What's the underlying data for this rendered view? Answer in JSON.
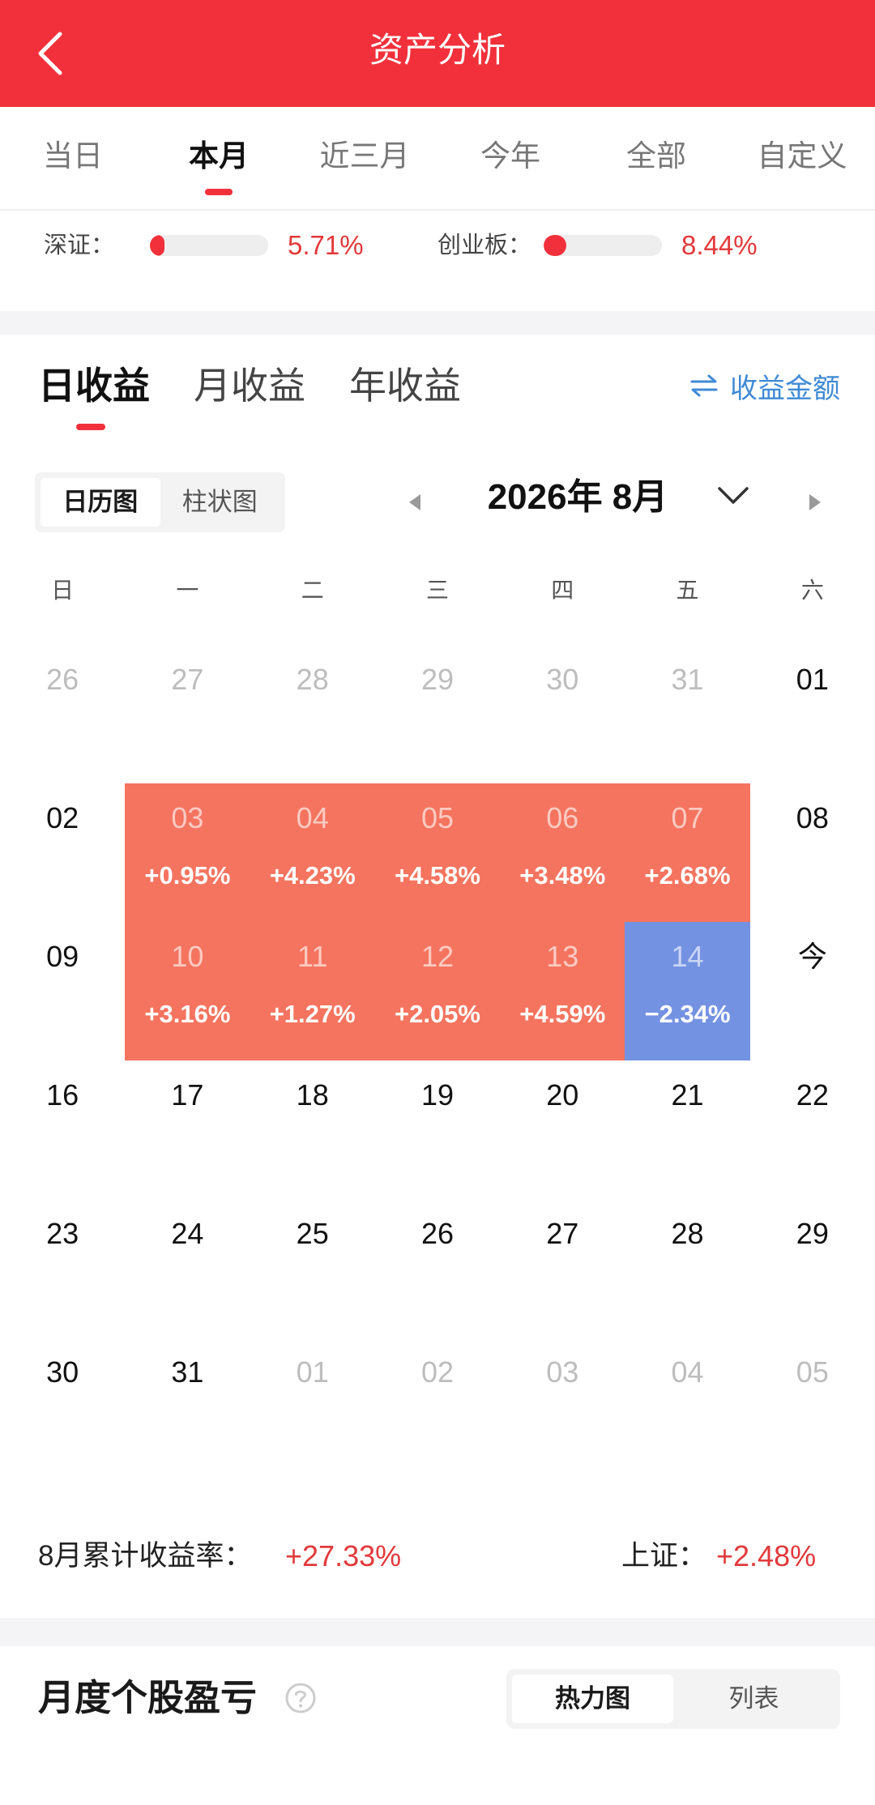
{
  "colors": {
    "brand_red": "#F2303B",
    "gain_text": "#E2393B",
    "gain_cell": "#F5745F",
    "loss_cell": "#7492E2",
    "link_blue": "#3F8AD5"
  },
  "header": {
    "title": "资产分析",
    "back_icon": "chevron-left-icon"
  },
  "period_tabs": {
    "items": [
      {
        "label": "当日",
        "active": false
      },
      {
        "label": "本月",
        "active": true
      },
      {
        "label": "近三月",
        "active": false
      },
      {
        "label": "今年",
        "active": false
      },
      {
        "label": "全部",
        "active": false
      },
      {
        "label": "自定义",
        "active": false
      }
    ]
  },
  "indices": [
    {
      "name": "深证：",
      "value": "5.71%",
      "bar_fill": 0.12
    },
    {
      "name": "创业板：",
      "value": "8.44%",
      "bar_fill": 0.19
    }
  ],
  "returns_tabs": {
    "items": [
      {
        "label": "日收益",
        "active": true
      },
      {
        "label": "月收益",
        "active": false
      },
      {
        "label": "年收益",
        "active": false
      }
    ],
    "toggle": {
      "icon": "swap-arrows-icon",
      "label": "收益金额"
    }
  },
  "view_toggle": {
    "options": [
      {
        "label": "日历图",
        "selected": true
      },
      {
        "label": "柱状图",
        "selected": false
      }
    ]
  },
  "month_nav": {
    "label": "2026年 8月",
    "prev_icon": "triangle-left-icon",
    "next_icon": "triangle-right-icon",
    "dropdown_icon": "chevron-down-icon"
  },
  "calendar": {
    "weekdays": [
      "日",
      "一",
      "二",
      "三",
      "四",
      "五",
      "六"
    ],
    "weeks": [
      [
        {
          "day": "26",
          "muted": true
        },
        {
          "day": "27",
          "muted": true
        },
        {
          "day": "28",
          "muted": true
        },
        {
          "day": "29",
          "muted": true
        },
        {
          "day": "30",
          "muted": true
        },
        {
          "day": "31",
          "muted": true
        },
        {
          "day": "01"
        }
      ],
      [
        {
          "day": "02"
        },
        {
          "day": "03",
          "pct": "+0.95%",
          "trend": "gain"
        },
        {
          "day": "04",
          "pct": "+4.23%",
          "trend": "gain"
        },
        {
          "day": "05",
          "pct": "+4.58%",
          "trend": "gain"
        },
        {
          "day": "06",
          "pct": "+3.48%",
          "trend": "gain"
        },
        {
          "day": "07",
          "pct": "+2.68%",
          "trend": "gain"
        },
        {
          "day": "08"
        }
      ],
      [
        {
          "day": "09"
        },
        {
          "day": "10",
          "pct": "+3.16%",
          "trend": "gain"
        },
        {
          "day": "11",
          "pct": "+1.27%",
          "trend": "gain"
        },
        {
          "day": "12",
          "pct": "+2.05%",
          "trend": "gain"
        },
        {
          "day": "13",
          "pct": "+4.59%",
          "trend": "gain"
        },
        {
          "day": "14",
          "pct": "−2.34%",
          "trend": "loss"
        },
        {
          "day": "今",
          "today": true
        }
      ],
      [
        {
          "day": "16"
        },
        {
          "day": "17"
        },
        {
          "day": "18"
        },
        {
          "day": "19"
        },
        {
          "day": "20"
        },
        {
          "day": "21"
        },
        {
          "day": "22"
        }
      ],
      [
        {
          "day": "23"
        },
        {
          "day": "24"
        },
        {
          "day": "25"
        },
        {
          "day": "26"
        },
        {
          "day": "27"
        },
        {
          "day": "28"
        },
        {
          "day": "29"
        }
      ],
      [
        {
          "day": "30"
        },
        {
          "day": "31"
        },
        {
          "day": "01",
          "muted": true
        },
        {
          "day": "02",
          "muted": true
        },
        {
          "day": "03",
          "muted": true
        },
        {
          "day": "04",
          "muted": true
        },
        {
          "day": "05",
          "muted": true
        }
      ]
    ]
  },
  "summary": {
    "label": "8月累计收益率：",
    "value": "+27.33%",
    "benchmark_label": "上证：",
    "benchmark_value": "+2.48%"
  },
  "monthly_pnl": {
    "title": "月度个股盈亏",
    "help_icon": "question-circle-icon",
    "view_options": [
      {
        "label": "热力图",
        "selected": true
      },
      {
        "label": "列表",
        "selected": false
      }
    ]
  }
}
